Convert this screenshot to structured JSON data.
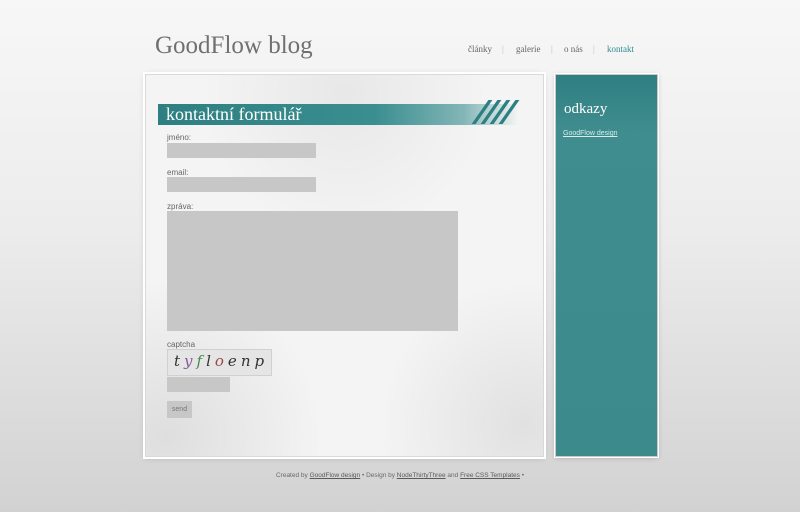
{
  "header": {
    "site_title": "GoodFlow blog"
  },
  "nav": {
    "items": [
      {
        "label": "články",
        "active": false
      },
      {
        "label": "galerie",
        "active": false
      },
      {
        "label": "o nás",
        "active": false
      },
      {
        "label": "kontakt",
        "active": true
      }
    ],
    "separator": "|"
  },
  "main": {
    "heading": "kontaktní formulář",
    "form": {
      "name_label": "jméno:",
      "name_value": "",
      "email_label": "email:",
      "email_value": "",
      "message_label": "zpráva:",
      "message_value": "",
      "captcha_label": "captcha",
      "captcha_image_text": "tyfloenp",
      "captcha_value": "",
      "send_label": "send"
    }
  },
  "sidebar": {
    "heading": "odkazy",
    "links": [
      {
        "label": "GoodFlow design"
      }
    ]
  },
  "footer": {
    "created_by": "Created by",
    "author_link": "GoodFlow design",
    "design_by": "Design by",
    "designer_link": "NodeThirtyThree",
    "and": "and",
    "templates_link": "Free CSS Templates",
    "bullet": "•"
  },
  "colors": {
    "accent_teal": "#3a8e90",
    "active_nav": "#2f8b8d",
    "input_gray": "#c7c7c7"
  }
}
